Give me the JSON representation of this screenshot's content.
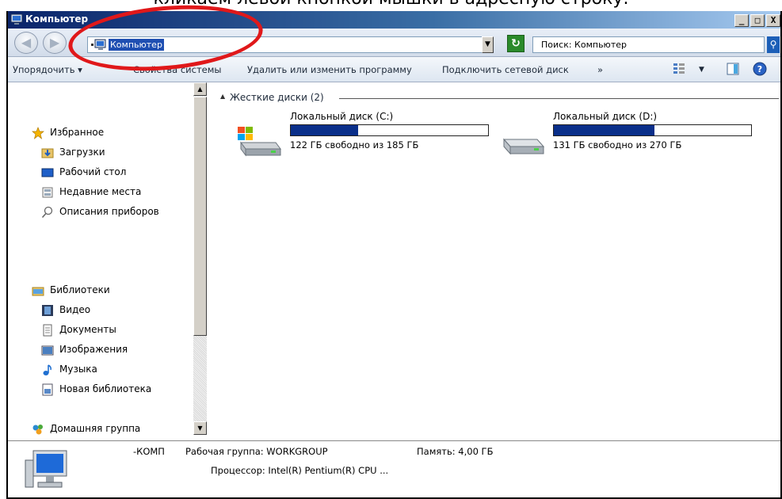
{
  "caption": "кликаем левой кнопкой мышки в адресную строку.",
  "window": {
    "title": "Компьютер",
    "buttons": {
      "minimize": "_",
      "maximize": "□",
      "close": "X"
    }
  },
  "address": {
    "path": "Компьютер",
    "search_placeholder": "Поиск: Компьютер"
  },
  "toolbar": {
    "organize": "Упорядочить ▾",
    "system_properties": "Свойства системы",
    "uninstall": "Удалить или изменить программу",
    "map_drive": "Подключить сетевой диск",
    "more": "»"
  },
  "nav": {
    "favorites": "Избранное",
    "downloads": "Загрузки",
    "desktop": "Рабочий стол",
    "recent": "Недавние места",
    "devices": "Описания приборов",
    "libraries": "Библиотеки",
    "video": "Видео",
    "documents": "Документы",
    "images": "Изображения",
    "music": "Музыка",
    "new_library": "Новая библиотека",
    "homegroup": "Домашняя группа"
  },
  "content": {
    "group_title": "Жесткие диски (2)",
    "drives": [
      {
        "name": "Локальный диск (C:)",
        "free": "122 ГБ свободно из 185 ГБ",
        "used_fraction": 0.34
      },
      {
        "name": "Локальный диск (D:)",
        "free": "131 ГБ свободно из 270 ГБ",
        "used_fraction": 0.51
      }
    ]
  },
  "details": {
    "name": "-КОМП",
    "workgroup": "Рабочая группа: WORKGROUP",
    "memory": "Память: 4,00 ГБ",
    "processor": "Процессор: Intel(R) Pentium(R) CPU ..."
  },
  "colors": {
    "annotation": "#e0181a",
    "drive_bar": "#0a2f8a",
    "address_highlight": "#1f4fb2"
  }
}
